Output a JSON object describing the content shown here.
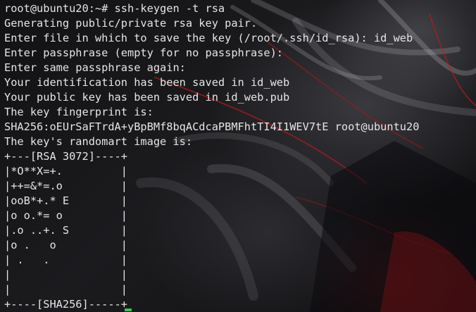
{
  "terminal": {
    "lines": [
      "root@ubuntu20:~# ssh-keygen -t rsa",
      "Generating public/private rsa key pair.",
      "Enter file in which to save the key (/root/.ssh/id_rsa): id_web",
      "Enter passphrase (empty for no passphrase):",
      "Enter same passphrase again:",
      "Your identification has been saved in id_web",
      "Your public key has been saved in id_web.pub",
      "The key fingerprint is:",
      "SHA256:oEUrSaFTrdA+yBpBMf8bqACdcaPBMFhtTI4I1WEV7tE root@ubuntu20",
      "The key's randomart image is:",
      "+---[RSA 3072]----+",
      "|*O**X=+.         |",
      "|++=&*=.o         |",
      "|ooB*+.* E        |",
      "|o o.*= o         |",
      "|.o ..+. S        |",
      "|o .   o          |",
      "| .   .           |",
      "|                 |",
      "|                 |",
      "+----[SHA256]-----+",
      ""
    ],
    "colors": {
      "text": "#e6e6e6",
      "cursor": "#2ecc40",
      "accent_red": "#b01818"
    }
  }
}
